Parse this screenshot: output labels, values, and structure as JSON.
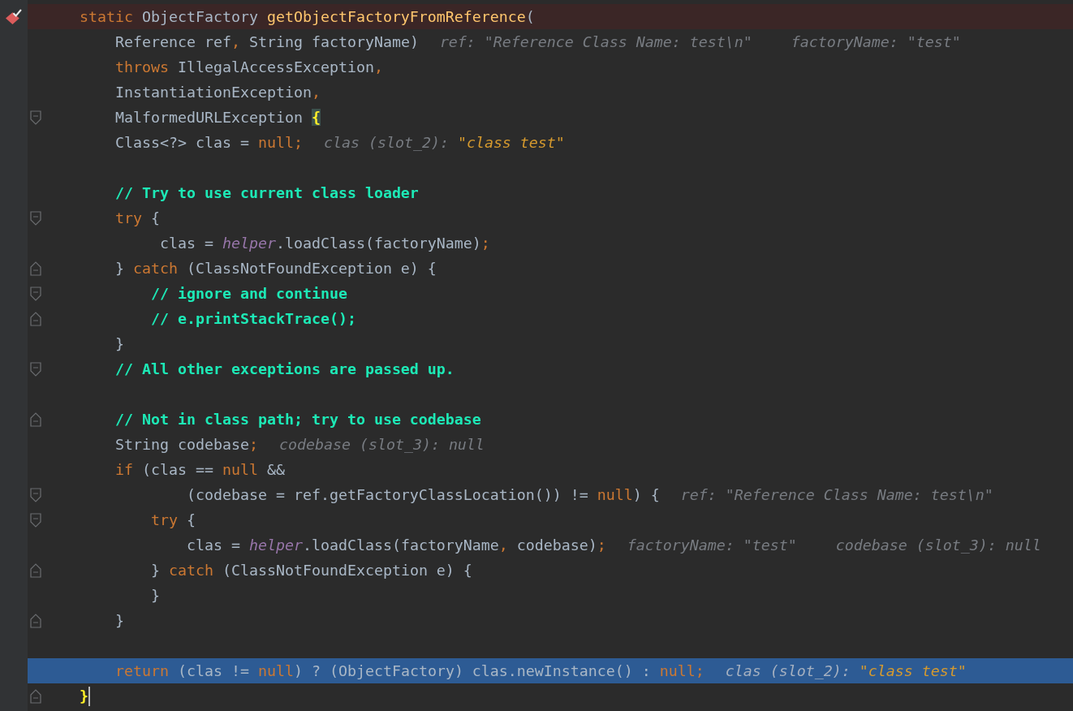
{
  "editor": {
    "lines": [
      {
        "breakpoint": true,
        "code": [
          {
            "kind": "keyword",
            "text": "    static"
          },
          {
            "kind": "plain",
            "text": " ObjectFactory "
          },
          {
            "kind": "method",
            "text": "getObjectFactoryFromReference"
          },
          {
            "kind": "plain",
            "text": "("
          }
        ]
      },
      {
        "code": [
          {
            "kind": "plain",
            "text": "        Reference ref"
          },
          {
            "kind": "punct",
            "text": ","
          },
          {
            "kind": "plain",
            "text": " String factoryName)"
          }
        ],
        "hints": [
          {
            "text": "ref: \"Reference Class Name: test\\n\""
          },
          {
            "text": "factoryName: \"test\""
          }
        ]
      },
      {
        "code": [
          {
            "kind": "keyword",
            "text": "        throws"
          },
          {
            "kind": "plain",
            "text": " IllegalAccessException"
          },
          {
            "kind": "punct",
            "text": ","
          }
        ]
      },
      {
        "code": [
          {
            "kind": "plain",
            "text": "        InstantiationException"
          },
          {
            "kind": "punct",
            "text": ","
          }
        ]
      },
      {
        "fold_start": true,
        "code": [
          {
            "kind": "plain",
            "text": "        MalformedURLException "
          },
          {
            "kind": "brace-match",
            "text": "{"
          }
        ]
      },
      {
        "code": [
          {
            "kind": "plain",
            "text": "        Class<?> clas = "
          },
          {
            "kind": "keyword",
            "text": "null"
          },
          {
            "kind": "punct",
            "text": ";"
          }
        ],
        "hints": [
          {
            "text": "clas (slot_2): ",
            "value": "\"class test\""
          }
        ]
      },
      {
        "gap_before": true,
        "code": [
          {
            "kind": "comment",
            "text": "        // Try to use current class loader"
          }
        ]
      },
      {
        "fold_start": true,
        "code": [
          {
            "kind": "keyword",
            "text": "        try"
          },
          {
            "kind": "plain",
            "text": " {"
          }
        ]
      },
      {
        "code": [
          {
            "kind": "plain",
            "text": "             clas = "
          },
          {
            "kind": "field",
            "text": "helper"
          },
          {
            "kind": "plain",
            "text": ".loadClass(factoryName)"
          },
          {
            "kind": "punct",
            "text": ";"
          }
        ]
      },
      {
        "fold_end": true,
        "code": [
          {
            "kind": "plain",
            "text": "        } "
          },
          {
            "kind": "keyword",
            "text": "catch"
          },
          {
            "kind": "plain",
            "text": " (ClassNotFoundException e) {"
          }
        ]
      },
      {
        "fold_start": true,
        "code": [
          {
            "kind": "comment",
            "text": "            // ignore and continue"
          }
        ]
      },
      {
        "fold_end": true,
        "code": [
          {
            "kind": "comment",
            "text": "            // e.printStackTrace();"
          }
        ]
      },
      {
        "code": [
          {
            "kind": "plain",
            "text": "        }"
          }
        ]
      },
      {
        "fold_start": true,
        "code": [
          {
            "kind": "comment",
            "text": "        // All other exceptions are passed up."
          }
        ]
      },
      {
        "gap_before": true,
        "fold_end": true,
        "code": [
          {
            "kind": "comment",
            "text": "        // Not in class path; try to use codebase"
          }
        ]
      },
      {
        "code": [
          {
            "kind": "plain",
            "text": "        String codebase"
          },
          {
            "kind": "punct",
            "text": ";"
          }
        ],
        "hints": [
          {
            "text": "codebase (slot_3): null"
          }
        ]
      },
      {
        "code": [
          {
            "kind": "keyword",
            "text": "        if"
          },
          {
            "kind": "plain",
            "text": " (clas == "
          },
          {
            "kind": "keyword",
            "text": "null"
          },
          {
            "kind": "plain",
            "text": " &&"
          }
        ]
      },
      {
        "fold_start": true,
        "code": [
          {
            "kind": "plain",
            "text": "                (codebase = ref.getFactoryClassLocation()) != "
          },
          {
            "kind": "keyword",
            "text": "null"
          },
          {
            "kind": "plain",
            "text": ") {"
          }
        ],
        "hints": [
          {
            "text": "ref: \"Reference Class Name: test\\n\""
          }
        ]
      },
      {
        "fold_start": true,
        "code": [
          {
            "kind": "keyword",
            "text": "            try"
          },
          {
            "kind": "plain",
            "text": " {"
          }
        ]
      },
      {
        "code": [
          {
            "kind": "plain",
            "text": "                clas = "
          },
          {
            "kind": "field",
            "text": "helper"
          },
          {
            "kind": "plain",
            "text": ".loadClass(factoryName"
          },
          {
            "kind": "punct",
            "text": ","
          },
          {
            "kind": "plain",
            "text": " codebase)"
          },
          {
            "kind": "punct",
            "text": ";"
          }
        ],
        "hints": [
          {
            "text": "factoryName: \"test\""
          },
          {
            "text": "codebase (slot_3): null"
          }
        ]
      },
      {
        "fold_end": true,
        "code": [
          {
            "kind": "plain",
            "text": "            } "
          },
          {
            "kind": "keyword",
            "text": "catch"
          },
          {
            "kind": "plain",
            "text": " (ClassNotFoundException e) {"
          }
        ]
      },
      {
        "code": [
          {
            "kind": "plain",
            "text": "            }"
          }
        ]
      },
      {
        "fold_end": true,
        "code": [
          {
            "kind": "plain",
            "text": "        }"
          }
        ]
      },
      {
        "gap_before": true,
        "execution_point": true,
        "code": [
          {
            "kind": "keyword",
            "text": "        return"
          },
          {
            "kind": "plain",
            "text": " (clas != "
          },
          {
            "kind": "keyword",
            "text": "null"
          },
          {
            "kind": "plain",
            "text": ") ? (ObjectFactory) clas.newInstance() : "
          },
          {
            "kind": "keyword",
            "text": "null"
          },
          {
            "kind": "punct",
            "text": ";"
          }
        ],
        "hints": [
          {
            "text": "clas (slot_2): ",
            "value": "\"class test\""
          }
        ]
      },
      {
        "fold_end": true,
        "caret": true,
        "code": [
          {
            "kind": "brace-match-indented",
            "text": "    }"
          }
        ]
      }
    ]
  }
}
